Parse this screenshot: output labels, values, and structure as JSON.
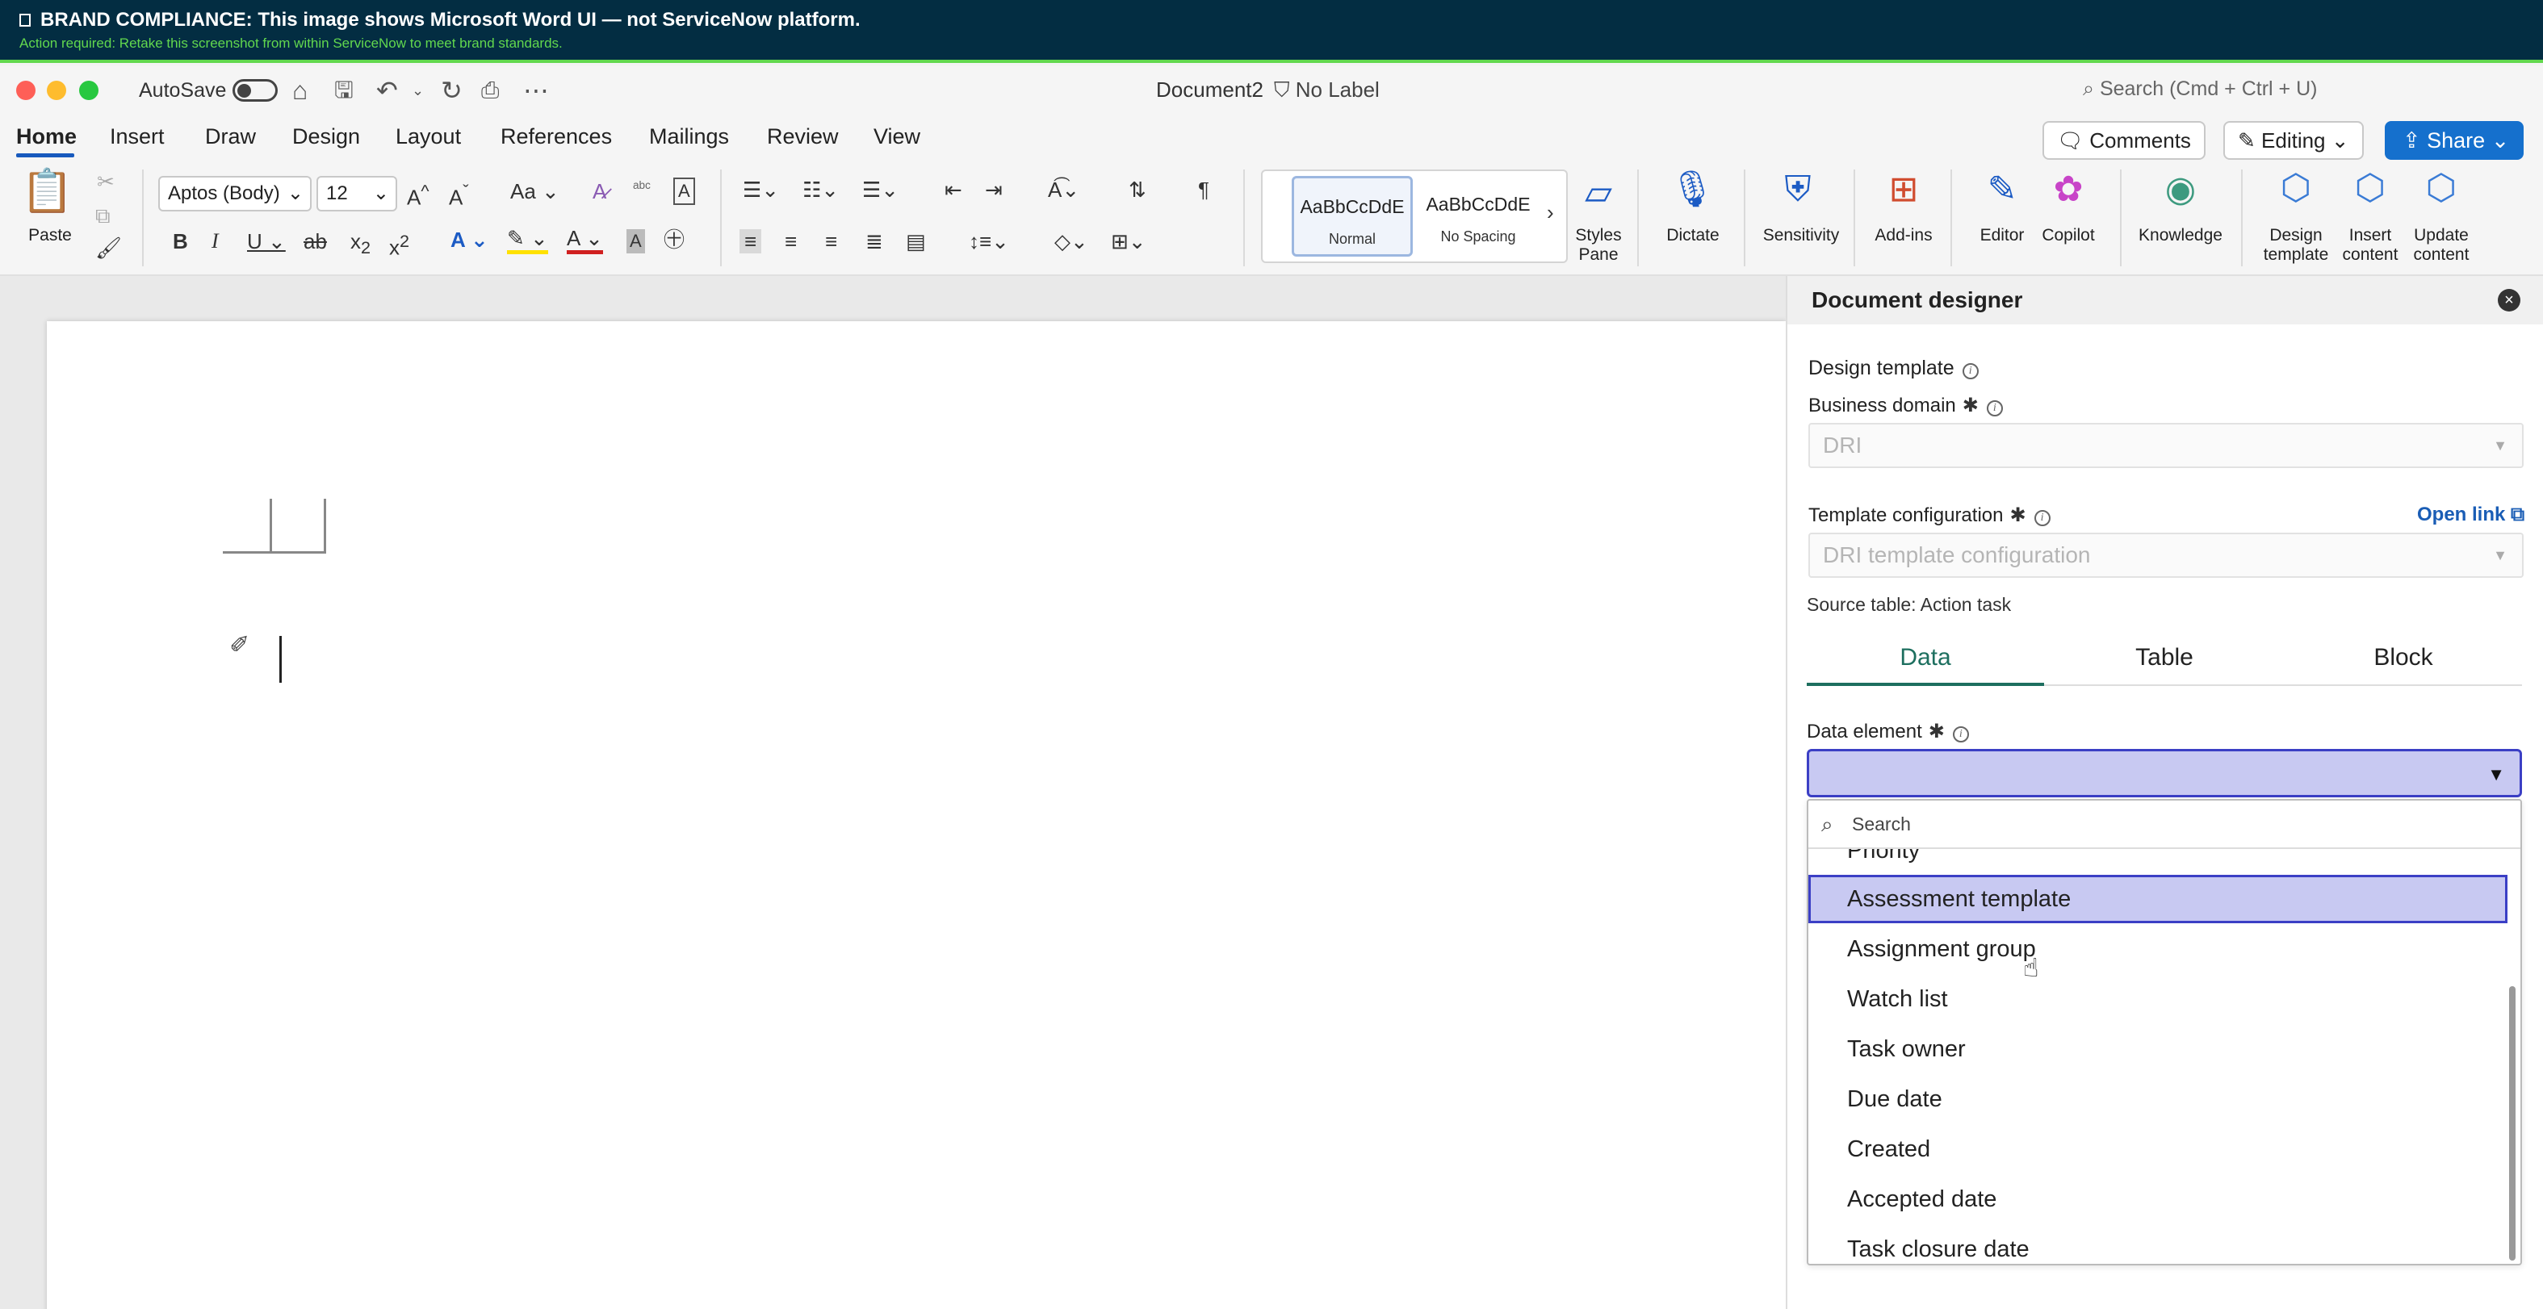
{
  "banner": {
    "title": "BRAND COMPLIANCE: This image shows Microsoft Word UI — not ServiceNow platform.",
    "subtitle": "Action required: Retake this screenshot from within ServiceNow to meet brand standards."
  },
  "titlebar": {
    "autosave": "AutoSave",
    "doc_title": "Document2",
    "label": "No Label",
    "search_placeholder": "Search (Cmd + Ctrl + U)"
  },
  "menu": {
    "items": [
      "Home",
      "Insert",
      "Draw",
      "Design",
      "Layout",
      "References",
      "Mailings",
      "Review",
      "View"
    ],
    "comments": "Comments",
    "editing": "Editing",
    "share": "Share"
  },
  "ribbon": {
    "paste": "Paste",
    "font_name": "Aptos (Body)",
    "font_size": "12",
    "case_label": "Aa",
    "styles": [
      {
        "sample": "AaBbCcDdE",
        "name": "Normal"
      },
      {
        "sample": "AaBbCcDdE",
        "name": "No Spacing"
      }
    ],
    "styles_pane": "Styles Pane",
    "dictate": "Dictate",
    "sensitivity": "Sensitivity",
    "addins": "Add-ins",
    "editor": "Editor",
    "copilot": "Copilot",
    "knowledge": "Knowledge",
    "design_template": "Design template",
    "insert_content": "Insert content",
    "update_content": "Update content"
  },
  "panel": {
    "title": "Document designer",
    "section": "Design template",
    "business_domain_label": "Business domain",
    "business_domain_value": "DRI",
    "template_config_label": "Template configuration",
    "template_config_value": "DRI template configuration",
    "open_link": "Open link",
    "source_table": "Source table: Action task",
    "tabs": [
      "Data",
      "Table",
      "Block"
    ],
    "data_element_label": "Data element",
    "search_placeholder": "Search",
    "options": [
      "Priority",
      "Assessment template",
      "Assignment group",
      "Watch list",
      "Task owner",
      "Due date",
      "Created",
      "Accepted date",
      "Task closure date"
    ]
  },
  "colors": {
    "banner_bg": "#032d42",
    "banner_accent": "#62d84e",
    "share_blue": "#1570cd",
    "highlight": "#c8c9f2",
    "tab_active": "#1d6f5f"
  }
}
